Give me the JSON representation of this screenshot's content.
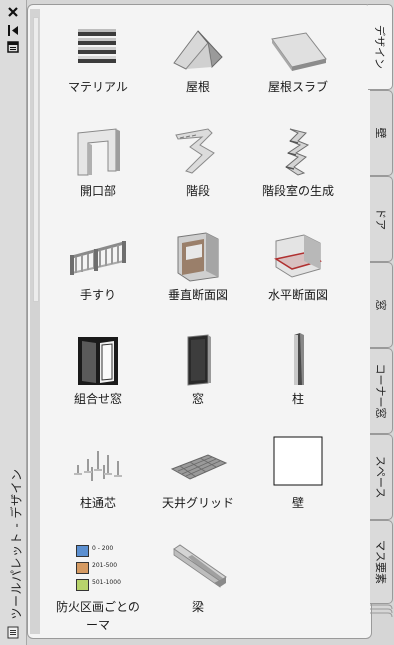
{
  "palette": {
    "title": "ツールパレット - デザイン",
    "tools": [
      {
        "label": "マテリアル",
        "icon": "material-icon"
      },
      {
        "label": "屋根",
        "icon": "roof-icon"
      },
      {
        "label": "屋根スラブ",
        "icon": "roof-slab-icon"
      },
      {
        "label": "開口部",
        "icon": "opening-icon"
      },
      {
        "label": "階段",
        "icon": "stair-icon"
      },
      {
        "label": "階段室の生成",
        "icon": "stairwell-icon"
      },
      {
        "label": "手すり",
        "icon": "railing-icon"
      },
      {
        "label": "垂直断面図",
        "icon": "vertical-section-icon"
      },
      {
        "label": "水平断面図",
        "icon": "horizontal-section-icon"
      },
      {
        "label": "組合せ窓",
        "icon": "assembly-window-icon"
      },
      {
        "label": "窓",
        "icon": "window-icon"
      },
      {
        "label": "柱",
        "icon": "column-icon"
      },
      {
        "label": "柱通芯",
        "icon": "column-grid-icon"
      },
      {
        "label": "天井グリッド",
        "icon": "ceiling-grid-icon"
      },
      {
        "label": "壁",
        "icon": "wall-icon"
      },
      {
        "label": "防火区画ごとの\nーマ",
        "icon": "fire-zone-theme-icon"
      },
      {
        "label": "梁",
        "icon": "beam-icon"
      }
    ],
    "legend": [
      {
        "text": "0 - 200",
        "color": "#5b8fd0"
      },
      {
        "text": "201-500",
        "color": "#d59a62"
      },
      {
        "text": "501-1000",
        "color": "#b7d36b"
      }
    ]
  },
  "tabs": [
    "デザイン",
    "壁",
    "ドア",
    "窓",
    "コーナー窓",
    "スペース",
    "マス要素"
  ]
}
